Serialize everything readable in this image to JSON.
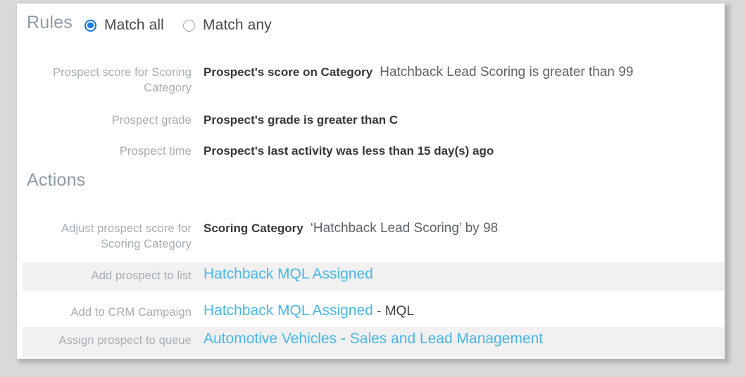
{
  "rules": {
    "heading": "Rules",
    "match_options": [
      {
        "label": "Match all",
        "selected": true
      },
      {
        "label": "Match any",
        "selected": false
      }
    ],
    "rows": [
      {
        "label": "Prospect score for Scoring Category",
        "value_bold": "Prospect's score on Category",
        "value_plain": "Hatchback Lead Scoring is greater than 99"
      },
      {
        "label": "Prospect grade",
        "value_bold": "Prospect's grade is greater than C",
        "value_plain": ""
      },
      {
        "label": "Prospect time",
        "value_bold": "Prospect's last activity was less than 15 day(s) ago",
        "value_plain": ""
      }
    ]
  },
  "actions": {
    "heading": "Actions",
    "rows": [
      {
        "label": "Adjust prospect score for Scoring Category",
        "value_bold": "Scoring Category",
        "value_plain": "‘Hatchback Lead Scoring’ by 98",
        "link": "",
        "suffix": ""
      },
      {
        "label": "Add prospect to list",
        "value_bold": "",
        "value_plain": "",
        "link": "Hatchback MQL Assigned",
        "suffix": ""
      },
      {
        "label": "Add to CRM Campaign",
        "value_bold": "",
        "value_plain": "",
        "link": "Hatchback MQL Assigned",
        "suffix": " - MQL"
      },
      {
        "label": "Assign prospect to queue",
        "value_bold": "",
        "value_plain": "",
        "link": "Automotive Vehicles - Sales and Lead Management",
        "suffix": ""
      }
    ]
  },
  "colors": {
    "heading": "#8d9aa5",
    "label": "#a6aeb4",
    "value": "#33383d",
    "link": "#45b8ec",
    "radio_selected": "#1a7ae8",
    "stripe": "#f2f0f1"
  }
}
